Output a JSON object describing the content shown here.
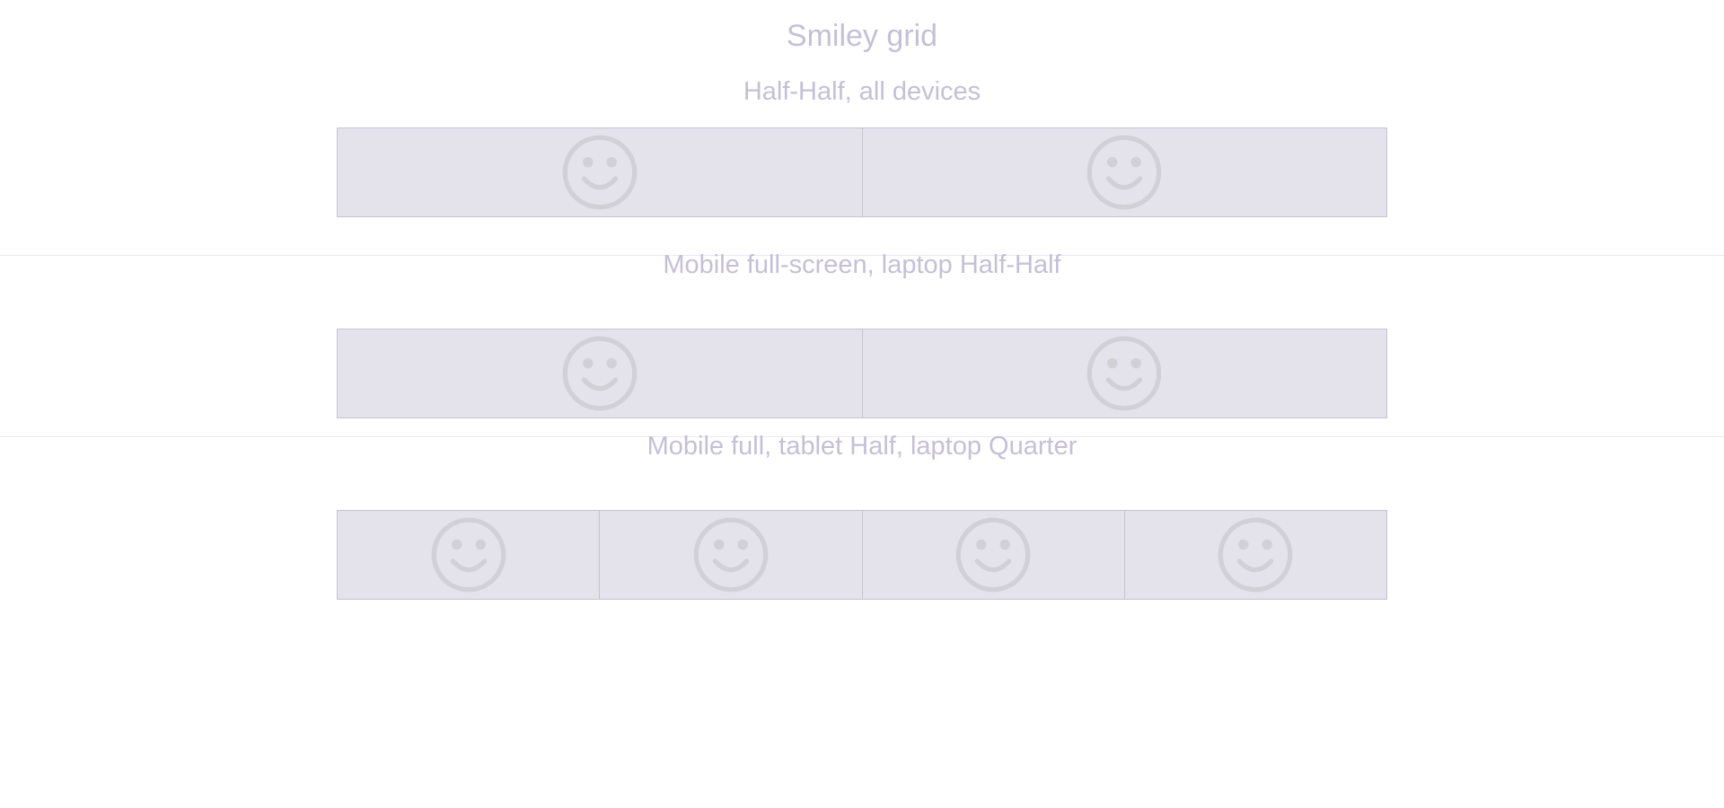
{
  "colors": {
    "text": "#c5c0d6",
    "cell_background": "#e4e2ea",
    "cell_border": "#c7c2d4",
    "divider": "#ece9f0",
    "smiley": "#d2d0d7"
  },
  "page": {
    "title": "Smiley grid"
  },
  "sections": [
    {
      "heading": "Half-Half, all devices",
      "cells": [
        {
          "icon": "smiley-icon"
        },
        {
          "icon": "smiley-icon"
        }
      ]
    },
    {
      "heading": "Mobile full-screen, laptop Half-Half",
      "cells": [
        {
          "icon": "smiley-icon"
        },
        {
          "icon": "smiley-icon"
        }
      ]
    },
    {
      "heading": "Mobile full, tablet Half, laptop Quarter",
      "cells": [
        {
          "icon": "smiley-icon"
        },
        {
          "icon": "smiley-icon"
        },
        {
          "icon": "smiley-icon"
        },
        {
          "icon": "smiley-icon"
        }
      ]
    }
  ]
}
